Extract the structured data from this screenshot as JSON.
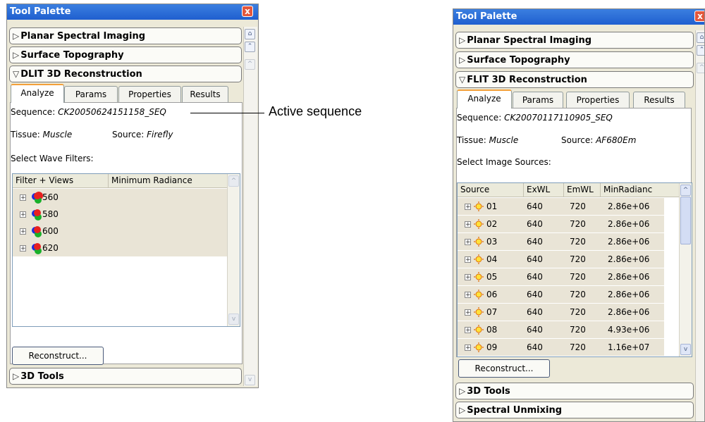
{
  "left": {
    "title": "Tool Palette",
    "close_label": "x",
    "sections": [
      {
        "label": "Planar Spectral Imaging",
        "expanded": false
      },
      {
        "label": "Surface Topography",
        "expanded": false
      },
      {
        "label": "DLIT 3D Reconstruction",
        "expanded": true
      }
    ],
    "tabs": [
      "Analyze",
      "Params",
      "Properties",
      "Results"
    ],
    "sequence_label": "Sequence:",
    "sequence_value": "CK20050624151158_SEQ",
    "tissue_label": "Tissue:",
    "tissue_value": "Muscle",
    "source_label": "Source:",
    "source_value": "Firefly",
    "select_label": "Select Wave Filters:",
    "columns": [
      "Filter + Views",
      "Minimum Radiance"
    ],
    "rows": [
      "560",
      "580",
      "600",
      "620"
    ],
    "button": "Reconstruct...",
    "bottom_section": "3D Tools"
  },
  "right": {
    "title": "Tool Palette",
    "close_label": "x",
    "sections": [
      {
        "label": "Planar Spectral Imaging",
        "expanded": false
      },
      {
        "label": "Surface Topography",
        "expanded": false
      },
      {
        "label": "FLIT 3D Reconstruction",
        "expanded": true
      }
    ],
    "tabs": [
      "Analyze",
      "Params",
      "Properties",
      "Results"
    ],
    "sequence_label": "Sequence:",
    "sequence_value": "CK20070117110905_SEQ",
    "tissue_label": "Tissue:",
    "tissue_value": "Muscle",
    "source_label": "Source:",
    "source_value": "AF680Em",
    "select_label": "Select Image Sources:",
    "columns": [
      "Source",
      "ExWL",
      "EmWL",
      "MinRadianc"
    ],
    "rows": [
      {
        "src": "01",
        "ex": "640",
        "em": "720",
        "min": "2.86e+06"
      },
      {
        "src": "02",
        "ex": "640",
        "em": "720",
        "min": "2.86e+06"
      },
      {
        "src": "03",
        "ex": "640",
        "em": "720",
        "min": "2.86e+06"
      },
      {
        "src": "04",
        "ex": "640",
        "em": "720",
        "min": "2.86e+06"
      },
      {
        "src": "05",
        "ex": "640",
        "em": "720",
        "min": "2.86e+06"
      },
      {
        "src": "06",
        "ex": "640",
        "em": "720",
        "min": "2.86e+06"
      },
      {
        "src": "07",
        "ex": "640",
        "em": "720",
        "min": "2.86e+06"
      },
      {
        "src": "08",
        "ex": "640",
        "em": "720",
        "min": "4.93e+06"
      },
      {
        "src": "09",
        "ex": "640",
        "em": "720",
        "min": "1.16e+07"
      }
    ],
    "button": "Reconstruct...",
    "bottom_sections": [
      "3D Tools",
      "Spectral Unmixing"
    ]
  },
  "callout": {
    "label": "Active sequence"
  },
  "colors": {
    "titlebar": "#2a6fd8",
    "active_tab_accent": "#f3a03a",
    "row_bg": "#e9e4d6",
    "close": "#e3573c"
  }
}
